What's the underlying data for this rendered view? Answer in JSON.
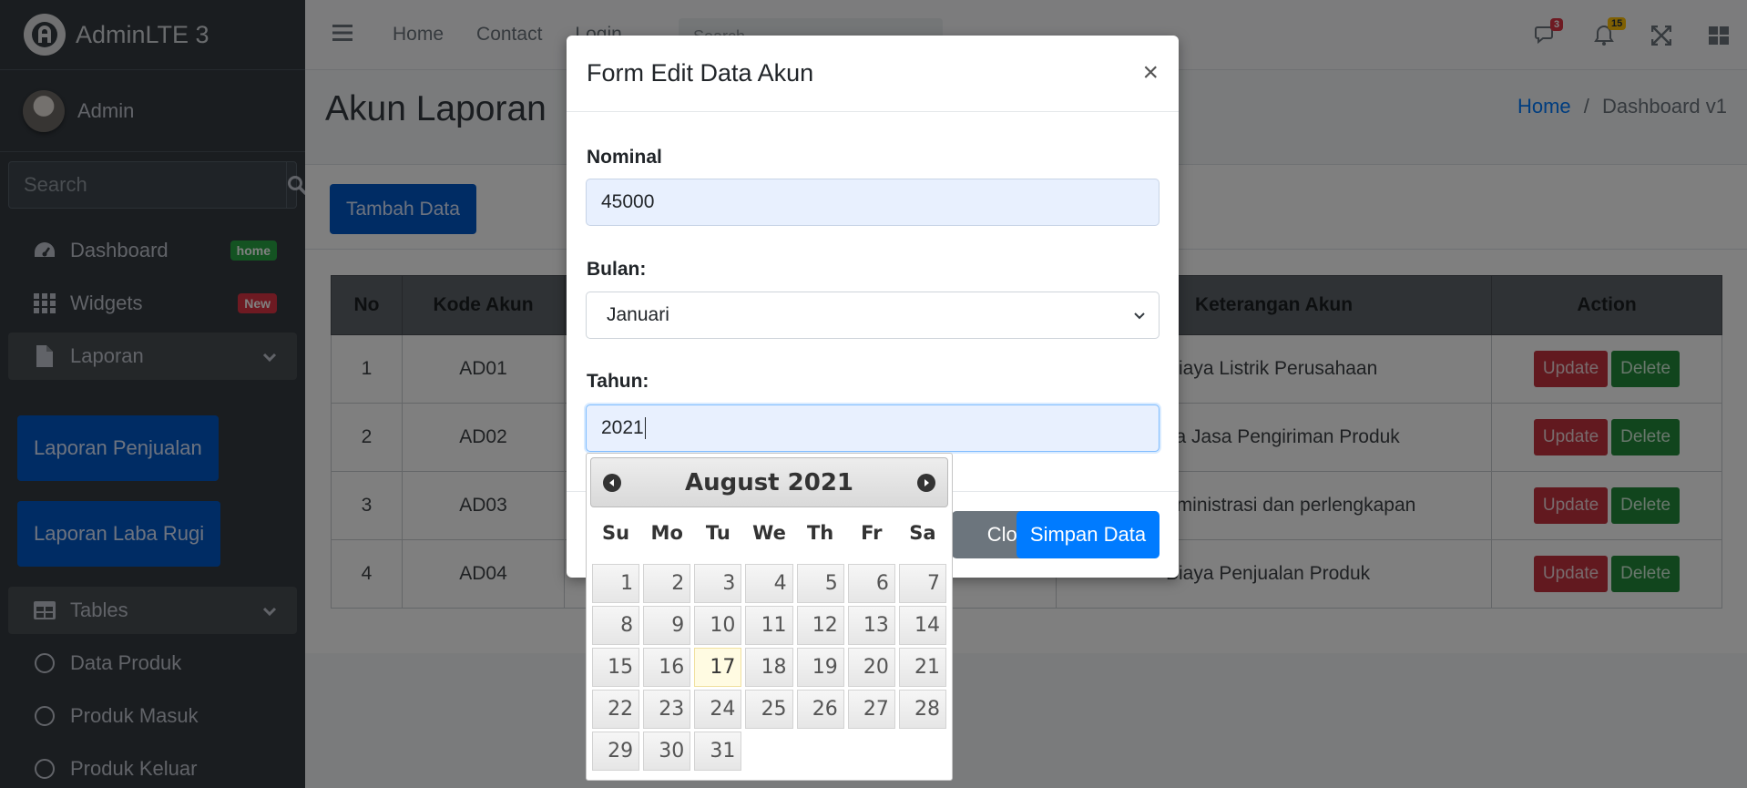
{
  "brand": {
    "name": "AdminLTE 3",
    "logo_icon": "adminlte-logo-icon"
  },
  "user": {
    "name": "Admin"
  },
  "sidebar": {
    "search_placeholder": "Search",
    "items": [
      {
        "label": "Dashboard",
        "badge": "home"
      },
      {
        "label": "Widgets",
        "badge": "New"
      },
      {
        "label": "Laporan"
      }
    ],
    "laporan_buttons": [
      "Laporan Penjualan",
      "Laporan Laba Rugi"
    ],
    "tables_label": "Tables",
    "tables_items": [
      "Data Produk",
      "Produk Masuk",
      "Produk Keluar"
    ]
  },
  "topnav": {
    "links": [
      "Home",
      "Contact",
      "Login"
    ],
    "search_placeholder": "Search",
    "messages_count": "3",
    "notifications_count": "15"
  },
  "page": {
    "title": "Akun Laporan",
    "breadcrumb": {
      "home": "Home",
      "separator": "/",
      "current": "Dashboard v1"
    },
    "add_button": "Tambah Data"
  },
  "table": {
    "headers": [
      "No",
      "Kode Akun",
      "Keterangan Akun",
      "Action"
    ],
    "rows": [
      {
        "no": "1",
        "kode": "AD01",
        "ket": "Biaya Listrik Perusahaan"
      },
      {
        "no": "2",
        "kode": "AD02",
        "ket": "ya Jasa Pengiriman Produk"
      },
      {
        "no": "3",
        "kode": "AD03",
        "ket": "dministrasi dan perlengkapan"
      },
      {
        "no": "4",
        "kode": "AD04",
        "ket": "Biaya Penjualan Produk"
      }
    ],
    "update_label": "Update",
    "delete_label": "Delete"
  },
  "modal": {
    "title": "Form Edit Data Akun",
    "close_symbol": "×",
    "nominal_label": "Nominal",
    "nominal_value": "45000",
    "bulan_label": "Bulan:",
    "bulan_value": "Januari",
    "tahun_label": "Tahun:",
    "tahun_value": "2021",
    "close_button": "Close",
    "save_button": "Simpan Data"
  },
  "datepicker": {
    "title": "August 2021",
    "weekdays": [
      "Su",
      "Mo",
      "Tu",
      "We",
      "Th",
      "Fr",
      "Sa"
    ],
    "days_in_month": 31,
    "first_weekday": 0,
    "today": 17
  },
  "colors": {
    "primary": "#007bff",
    "sidebar_bg": "#343a40",
    "success": "#28a745",
    "danger": "#dc3545"
  }
}
